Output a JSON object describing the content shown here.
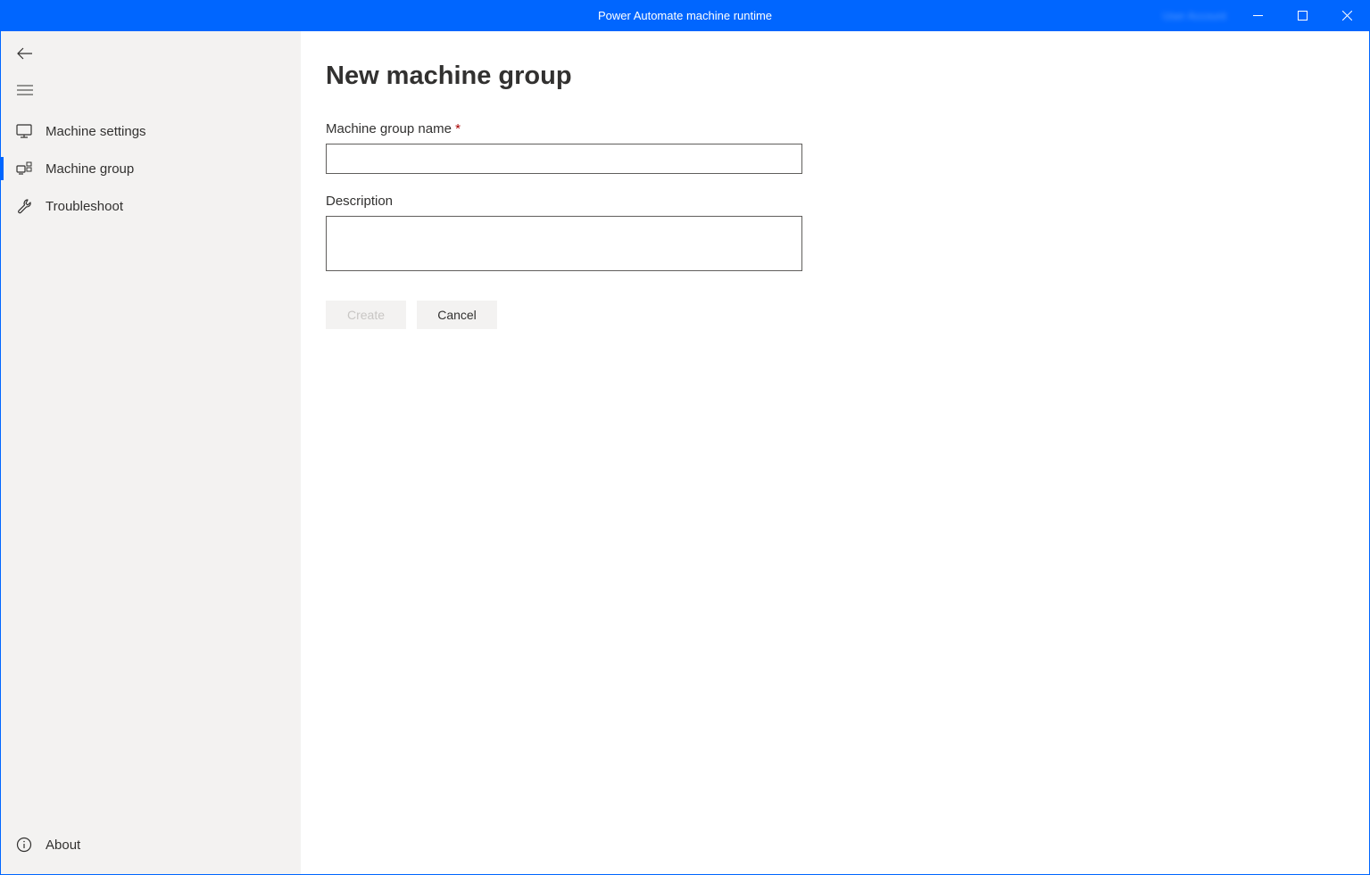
{
  "titlebar": {
    "title": "Power Automate machine runtime",
    "user": "User Account"
  },
  "sidebar": {
    "items": [
      {
        "label": "Machine settings"
      },
      {
        "label": "Machine group"
      },
      {
        "label": "Troubleshoot"
      }
    ],
    "footer": {
      "about": "About"
    }
  },
  "main": {
    "title": "New machine group",
    "form": {
      "name_label": "Machine group name",
      "name_value": "",
      "description_label": "Description",
      "description_value": ""
    },
    "buttons": {
      "create": "Create",
      "cancel": "Cancel"
    }
  }
}
